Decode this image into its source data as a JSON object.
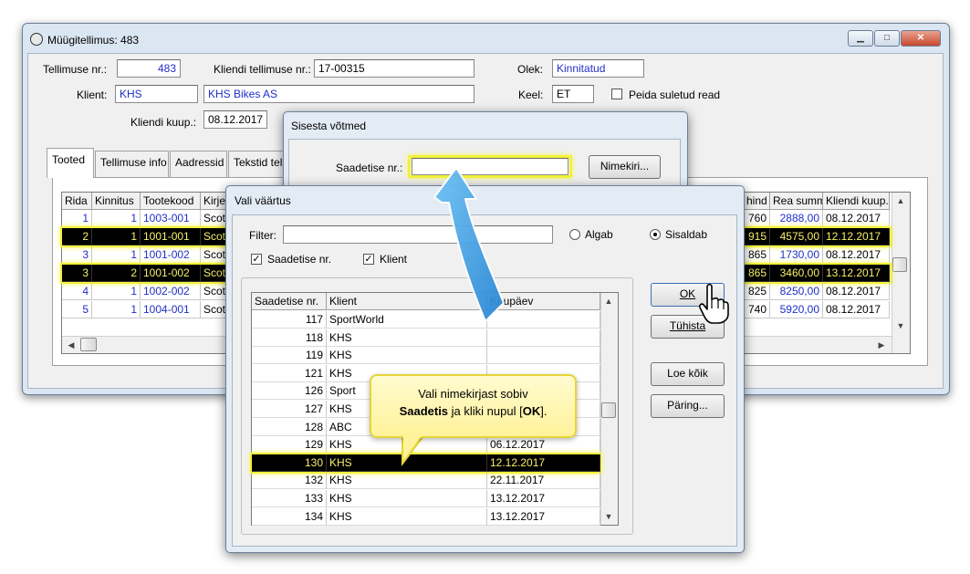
{
  "main_window": {
    "title": "Müügitellimus: 483",
    "order_no_label": "Tellimuse nr.:",
    "order_no": "483",
    "client_order_label": "Kliendi tellimuse nr.:",
    "client_order_no": "17-00315",
    "status_label": "Olek:",
    "status": "Kinnitatud",
    "client_label": "Klient:",
    "client_code": "KHS",
    "client_name": "KHS Bikes AS",
    "language_label": "Keel:",
    "language": "ET",
    "hide_closed_label": "Peida suletud read",
    "client_date_label": "Kliendi kuup.:",
    "client_date": "08.12.2017",
    "tabs": [
      "Tooted",
      "Tellimuse info",
      "Aadressid",
      "Tekstid tel"
    ],
    "grid": {
      "left_headers": [
        "Rida",
        "Kinnitus",
        "Tootekood",
        "Kirjel"
      ],
      "right_headers": [
        "hind",
        "Rea summ",
        "Kliendi kuup."
      ],
      "rows": [
        {
          "rida": "1",
          "kinnitus": "1",
          "kood": "1003-001",
          "kirj": "Scot",
          "hind": "760",
          "summa": "2888,00",
          "kuup": "08.12.2017"
        },
        {
          "rida": "2",
          "kinnitus": "1",
          "kood": "1001-001",
          "kirj": "Scot",
          "hind": "915",
          "summa": "4575,00",
          "kuup": "12.12.2017"
        },
        {
          "rida": "3",
          "kinnitus": "1",
          "kood": "1001-002",
          "kirj": "Scot",
          "hind": "865",
          "summa": "1730,00",
          "kuup": "08.12.2017"
        },
        {
          "rida": "3",
          "kinnitus": "2",
          "kood": "1001-002",
          "kirj": "Scot",
          "hind": "865",
          "summa": "3460,00",
          "kuup": "13.12.2017"
        },
        {
          "rida": "4",
          "kinnitus": "1",
          "kood": "1002-002",
          "kirj": "Scot",
          "hind": "825",
          "summa": "8250,00",
          "kuup": "08.12.2017"
        },
        {
          "rida": "5",
          "kinnitus": "1",
          "kood": "1004-001",
          "kirj": "Scot",
          "hind": "740",
          "summa": "5920,00",
          "kuup": "08.12.2017"
        }
      ]
    }
  },
  "keys_dialog": {
    "title": "Sisesta võtmed",
    "shipment_label": "Saadetise nr.:",
    "shipment_value": "",
    "list_button": "Nimekiri..."
  },
  "value_dialog": {
    "title": "Vali väärtus",
    "filter_label": "Filter:",
    "filter_value": "",
    "radio_starts": "Algab",
    "radio_contains": "Sisaldab",
    "check_shipment": "Saadetise nr.",
    "check_client": "Klient",
    "columns": [
      "Saadetise nr.",
      "Klient",
      "Kuupäev"
    ],
    "rows": [
      {
        "nr": "117",
        "client": "SportWorld",
        "date": ""
      },
      {
        "nr": "118",
        "client": "KHS",
        "date": ""
      },
      {
        "nr": "119",
        "client": "KHS",
        "date": ""
      },
      {
        "nr": "121",
        "client": "KHS",
        "date": ""
      },
      {
        "nr": "126",
        "client": "Sport",
        "date": ""
      },
      {
        "nr": "127",
        "client": "KHS",
        "date": ""
      },
      {
        "nr": "128",
        "client": "ABC",
        "date": ""
      },
      {
        "nr": "129",
        "client": "KHS",
        "date": "06.12.2017"
      },
      {
        "nr": "130",
        "client": "KHS",
        "date": "12.12.2017"
      },
      {
        "nr": "132",
        "client": "KHS",
        "date": "22.11.2017"
      },
      {
        "nr": "133",
        "client": "KHS",
        "date": "13.12.2017"
      },
      {
        "nr": "134",
        "client": "KHS",
        "date": "13.12.2017"
      }
    ],
    "ok_button": "OK",
    "cancel_button": "Tühista",
    "read_all_button": "Loe kõik",
    "query_button": "Päring..."
  },
  "callout": {
    "line1": "Vali nimekirjast sobiv",
    "bold1": "Saadetis",
    "mid": " ja kliki nupul [",
    "bold2": "OK",
    "end": "]."
  },
  "colors": {
    "highlight": "#f2f23a",
    "link_blue": "#1f2fc8",
    "arrow": "#3aa0e8"
  }
}
